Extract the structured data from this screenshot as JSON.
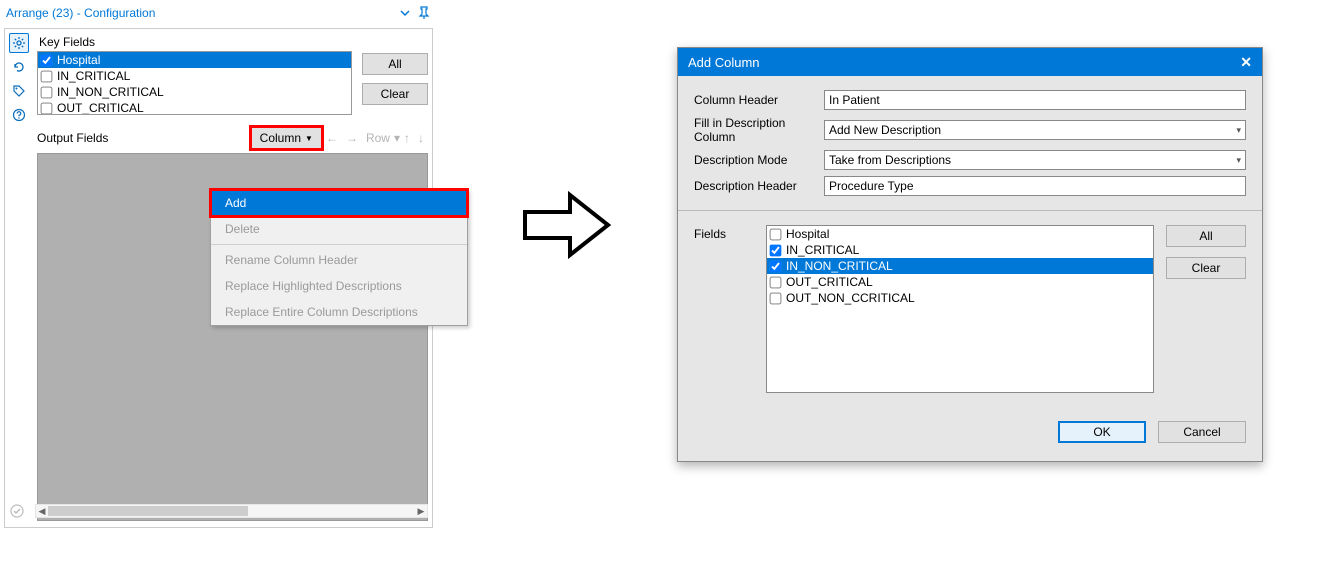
{
  "left": {
    "title": "Arrange (23) - Configuration",
    "key_fields_label": "Key Fields",
    "output_fields_label": "Output Fields",
    "items": [
      {
        "label": "Hospital",
        "checked": true,
        "selected": true
      },
      {
        "label": "IN_CRITICAL",
        "checked": false,
        "selected": false
      },
      {
        "label": "IN_NON_CRITICAL",
        "checked": false,
        "selected": false
      },
      {
        "label": "OUT_CRITICAL",
        "checked": false,
        "selected": false
      }
    ],
    "all_btn": "All",
    "clear_btn": "Clear",
    "column_btn": "Column",
    "row_btn": "Row",
    "menu": {
      "add": "Add",
      "delete": "Delete",
      "rename": "Rename Column Header",
      "replace_hl": "Replace Highlighted Descriptions",
      "replace_all": "Replace Entire Column Descriptions"
    }
  },
  "dialog": {
    "title": "Add Column",
    "col_header_label": "Column Header",
    "col_header_value": "In Patient",
    "fill_desc_label": "Fill in Description Column",
    "fill_desc_value": "Add New Description",
    "desc_mode_label": "Description Mode",
    "desc_mode_value": "Take from Descriptions",
    "desc_header_label": "Description Header",
    "desc_header_value": "Procedure Type",
    "fields_label": "Fields",
    "fields": [
      {
        "label": "Hospital",
        "checked": false,
        "selected": false
      },
      {
        "label": "IN_CRITICAL",
        "checked": true,
        "selected": false
      },
      {
        "label": "IN_NON_CRITICAL",
        "checked": true,
        "selected": true
      },
      {
        "label": "OUT_CRITICAL",
        "checked": false,
        "selected": false
      },
      {
        "label": "OUT_NON_CCRITICAL",
        "checked": false,
        "selected": false
      }
    ],
    "all_btn": "All",
    "clear_btn": "Clear",
    "ok_btn": "OK",
    "cancel_btn": "Cancel"
  }
}
